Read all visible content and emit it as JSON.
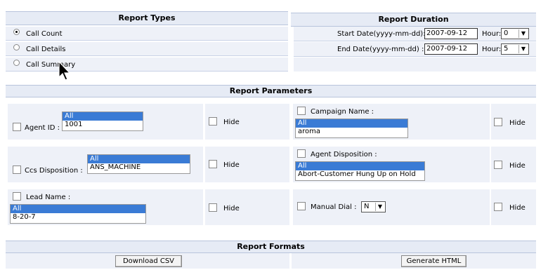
{
  "report_types": {
    "title": "Report Types",
    "options": [
      {
        "label": "Call Count",
        "selected": true
      },
      {
        "label": "Call Details",
        "selected": false
      },
      {
        "label": "Call Summary",
        "selected": false
      }
    ]
  },
  "report_duration": {
    "title": "Report Duration",
    "start_label": "Start Date(yyyy-mm-dd):",
    "start_value": "2007-09-12",
    "start_hour_label": "Hour:",
    "start_hour": "0",
    "end_label": "End Date(yyyy-mm-dd) :",
    "end_value": "2007-09-12",
    "end_hour_label": "Hour:",
    "end_hour": "5"
  },
  "report_parameters": {
    "title": "Report Parameters",
    "hide_label": "Hide",
    "agent_id": {
      "label": "Agent ID :",
      "options": [
        "All",
        "1001"
      ]
    },
    "campaign": {
      "label": "Campaign Name :",
      "options": [
        "All",
        "aroma"
      ]
    },
    "ccs_disposition": {
      "label": "Ccs Disposition :",
      "options": [
        "All",
        "ANS_MACHINE"
      ]
    },
    "agent_disposition": {
      "label": "Agent Disposition :",
      "options": [
        "All",
        "Abort-Customer Hung Up on Hold"
      ]
    },
    "lead_name": {
      "label": "Lead Name :",
      "options": [
        "All",
        "8-20-7"
      ]
    },
    "manual_dial": {
      "label": "Manual Dial :",
      "value": "N"
    }
  },
  "report_formats": {
    "title": "Report Formats",
    "csv_button": "Download CSV",
    "html_button": "Generate HTML"
  }
}
